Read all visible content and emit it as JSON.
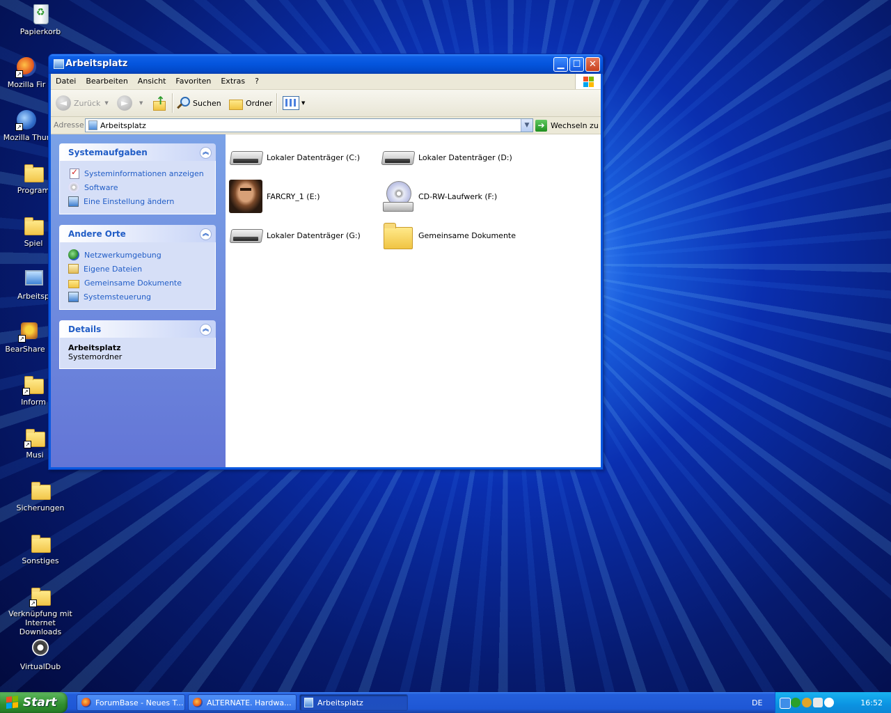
{
  "desktop": {
    "icons": [
      {
        "label": "Papierkorb",
        "icon": "recycle-bin-icon"
      },
      {
        "label": "Mozilla Fir",
        "icon": "firefox-icon"
      },
      {
        "label": "Mozilla Thur",
        "icon": "thunderbird-icon"
      },
      {
        "label": "Program",
        "icon": "folder-icon"
      },
      {
        "label": "Spiel",
        "icon": "folder-icon"
      },
      {
        "label": "Arbeitsp",
        "icon": "my-computer-icon"
      },
      {
        "label": "BearShare D",
        "icon": "bearshare-icon"
      },
      {
        "label": "Inform",
        "icon": "folder-icon"
      },
      {
        "label": "Musi",
        "icon": "folder-icon"
      },
      {
        "label": "Sicherungen",
        "icon": "folder-icon"
      },
      {
        "label": "Sonstiges",
        "icon": "folder-icon"
      },
      {
        "label": "Verknüpfung mit Internet Downloads",
        "icon": "folder-icon"
      },
      {
        "label": "VirtualDub",
        "icon": "gear-icon"
      }
    ]
  },
  "window": {
    "title": "Arbeitsplatz",
    "menu": [
      "Datei",
      "Bearbeiten",
      "Ansicht",
      "Favoriten",
      "Extras",
      "?"
    ],
    "toolbar": {
      "back": "Zurück",
      "search": "Suchen",
      "folders": "Ordner"
    },
    "address": {
      "label": "Adresse",
      "value": "Arbeitsplatz",
      "go": "Wechseln zu"
    },
    "panels": {
      "system_tasks": {
        "title": "Systemaufgaben",
        "links": [
          "Systeminformationen anzeigen",
          "Software",
          "Eine Einstellung ändern"
        ]
      },
      "other_places": {
        "title": "Andere Orte",
        "links": [
          "Netzwerkumgebung",
          "Eigene Dateien",
          "Gemeinsame Dokumente",
          "Systemsteuerung"
        ]
      },
      "details": {
        "title": "Details",
        "name": "Arbeitsplatz",
        "type": "Systemordner"
      }
    },
    "items": [
      {
        "label": "Lokaler Datenträger (C:)",
        "icon": "hard-drive-icon"
      },
      {
        "label": "Lokaler Datenträger (D:)",
        "icon": "hard-drive-icon"
      },
      {
        "label": "FARCRY_1 (E:)",
        "icon": "game-disc-icon"
      },
      {
        "label": "CD-RW-Laufwerk (F:)",
        "icon": "cd-drive-icon"
      },
      {
        "label": "Lokaler Datenträger (G:)",
        "icon": "hard-drive-icon"
      },
      {
        "label": "Gemeinsame Dokumente",
        "icon": "folder-icon"
      }
    ]
  },
  "taskbar": {
    "start": "Start",
    "tasks": [
      {
        "label": "ForumBase - Neues T...",
        "icon": "firefox-icon"
      },
      {
        "label": "ALTERNATE. Hardwa...",
        "icon": "firefox-icon"
      },
      {
        "label": "Arbeitsplatz",
        "icon": "my-computer-icon"
      }
    ],
    "language": "DE",
    "clock": "16:52"
  }
}
